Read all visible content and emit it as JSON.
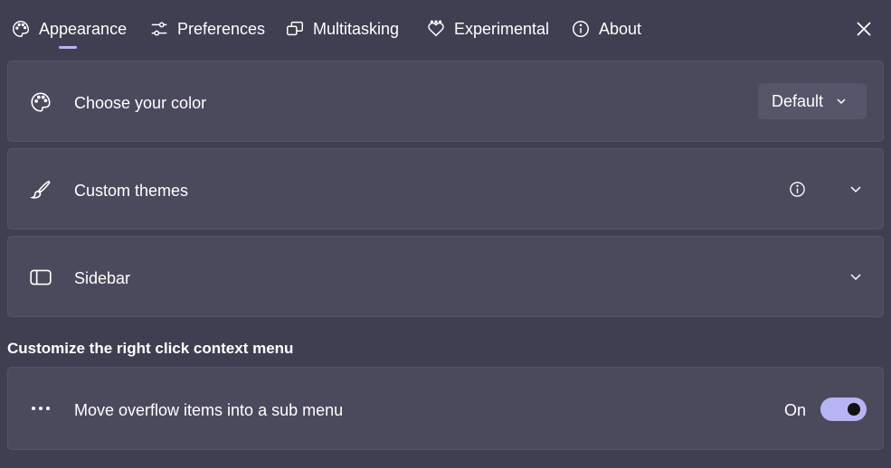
{
  "tabs": [
    {
      "label": "Appearance",
      "icon": "palette-icon",
      "active": true
    },
    {
      "label": "Preferences",
      "icon": "sliders-icon",
      "active": false
    },
    {
      "label": "Multitasking",
      "icon": "windows-icon",
      "active": false
    },
    {
      "label": "Experimental",
      "icon": "heart-beaker-icon",
      "active": false
    },
    {
      "label": "About",
      "icon": "info-icon",
      "active": false
    }
  ],
  "window": {
    "close_icon": "close-icon"
  },
  "settings": {
    "color": {
      "label": "Choose your color",
      "value": "Default"
    },
    "themes": {
      "label": "Custom themes"
    },
    "sidebar": {
      "label": "Sidebar"
    }
  },
  "context_menu": {
    "section_title": "Customize the right click context menu",
    "overflow": {
      "label": "Move overflow items into a sub menu",
      "state_label": "On",
      "enabled": true
    }
  },
  "colors": {
    "background": "#3f3f52",
    "card": "#4b4a5d",
    "accent": "#b7b4f4"
  }
}
